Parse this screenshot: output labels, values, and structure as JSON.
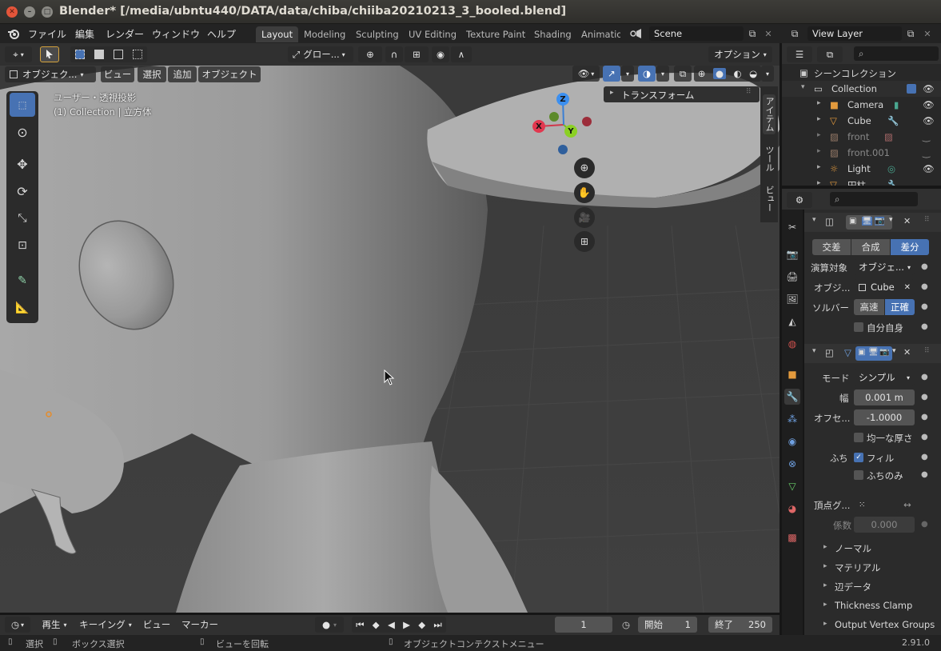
{
  "window": {
    "title": "Blender* [/media/ubntu440/DATA/data/chiba/chiiba20210213_3_booled.blend]"
  },
  "menu": [
    "ファイル",
    "編集",
    "レンダー",
    "ウィンドウ",
    "ヘルプ"
  ],
  "workspaces": [
    {
      "label": "Layout",
      "active": true
    },
    {
      "label": "Modeling"
    },
    {
      "label": "Sculpting"
    },
    {
      "label": "UV Editing"
    },
    {
      "label": "Texture Paint"
    },
    {
      "label": "Shading"
    },
    {
      "label": "Animatio"
    }
  ],
  "scene": {
    "name": "Scene"
  },
  "view_layer": {
    "name": "View Layer"
  },
  "viewport": {
    "transform_orientation": "グロー...",
    "options_label": "オプション",
    "mode": "オブジェク...",
    "menus": [
      "ビュー",
      "選択",
      "追加",
      "オブジェクト"
    ],
    "view_info": "ユーザー・透視投影",
    "collection_info": "(1) Collection | 立方体",
    "npanel_section": "トランスフォーム",
    "npanel_tabs": [
      "アイテム",
      "ツール",
      "ビュー"
    ],
    "gizmo_axes": {
      "x": "X",
      "y": "Y",
      "z": "Z"
    }
  },
  "outliner": {
    "title": "シーンコレクション",
    "rows": [
      {
        "name": "Collection",
        "icon": "collection-icon"
      },
      {
        "name": "Camera",
        "icon": "camera-icon"
      },
      {
        "name": "Cube",
        "icon": "mesh-icon"
      },
      {
        "name": "front",
        "icon": "image-icon"
      },
      {
        "name": "front.001",
        "icon": "image-icon"
      },
      {
        "name": "Light",
        "icon": "light-icon"
      },
      {
        "name": "円柱",
        "icon": "mesh-icon"
      }
    ]
  },
  "boolean_modifier": {
    "ops": [
      "交差",
      "合成",
      "差分"
    ],
    "active_op": "差分",
    "operand_label": "演算対象",
    "operand_value": "オブジェ...",
    "object_label": "オブジ...",
    "object_value": "Cube",
    "solver_label": "ソルバー",
    "solver_options": [
      "高速",
      "正確"
    ],
    "active_solver": "正確",
    "self_label": "自分自身"
  },
  "solidify_modifier": {
    "mode_label": "モード",
    "mode_value": "シンプル",
    "thickness_label": "幅",
    "thickness_value": "0.001 m",
    "offset_label": "オフセ...",
    "offset_value": "-1.0000",
    "even_label": "均一な厚さ",
    "rim_label": "ふち",
    "fill_label": "フィル",
    "only_rim_label": "ふちのみ",
    "vgroup_label": "頂点グ...",
    "factor_label": "係数",
    "factor_value": "0.000",
    "subpanels": [
      "ノーマル",
      "マテリアル",
      "辺データ",
      "Thickness Clamp",
      "Output Vertex Groups"
    ]
  },
  "timeline": {
    "playback": "再生",
    "keying": "キーイング",
    "view": "ビュー",
    "marker": "マーカー",
    "current_frame": "1",
    "start_label": "開始",
    "start": "1",
    "end_label": "終了",
    "end": "250"
  },
  "status": {
    "select": "選択",
    "box_select": "ボックス選択",
    "rotate_view": "ビューを回転",
    "context_menu": "オブジェクトコンテクストメニュー",
    "version": "2.91.0"
  }
}
